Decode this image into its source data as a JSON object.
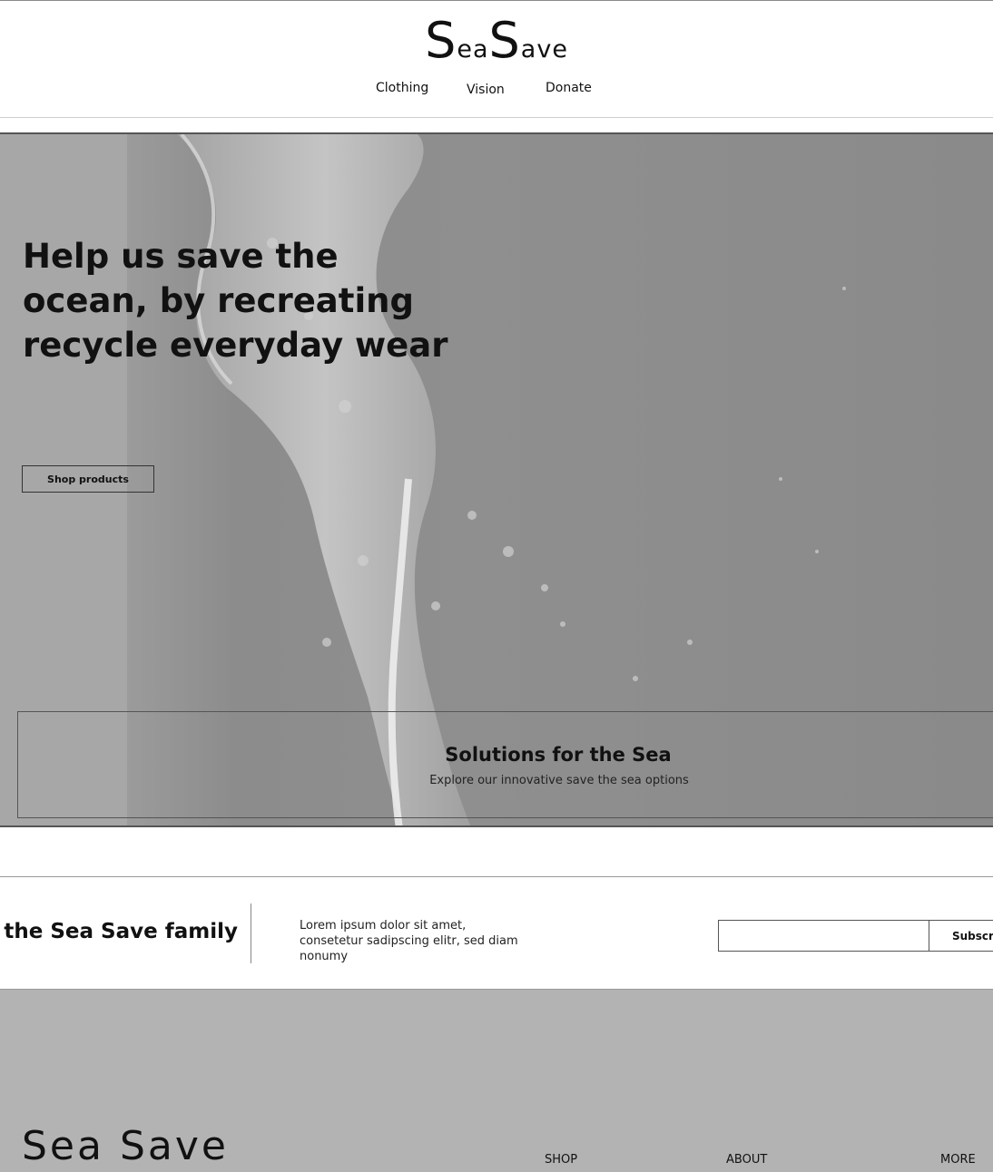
{
  "header": {
    "logo": {
      "cap1": "S",
      "rest1": "ea",
      "cap2": "S",
      "rest2": "ave"
    },
    "nav": {
      "clothing": "Clothing",
      "vision": "Vision",
      "donate": "Donate"
    }
  },
  "hero": {
    "title": "Help us save the ocean, by recreating recycle everyday wear",
    "cta": "Shop products",
    "solutions": {
      "title": "Solutions for the Sea",
      "subtitle": "Explore our innovative save the sea options"
    }
  },
  "newsletter": {
    "heading": "Join the Sea Save family",
    "text": "Lorem ipsum dolor sit amet, consetetur sadipscing elitr, sed diam nonumy",
    "email_value": "",
    "subscribe": "Subscribe"
  },
  "footer": {
    "logo": "Sea Save",
    "links": {
      "shop": "SHOP",
      "about": "ABOUT",
      "more": "MORE"
    }
  }
}
